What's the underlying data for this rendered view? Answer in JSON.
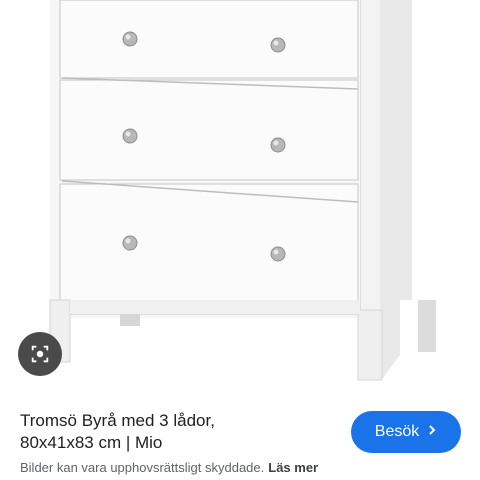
{
  "product": {
    "title_line1": "Tromsö Byrå med 3 lådor,",
    "title_line2": "80x41x83 cm | Mio",
    "image_subject": "white-3-drawer-chest"
  },
  "actions": {
    "visit_label": "Besök",
    "visit_icon": "chevron-right-icon",
    "lens_icon": "lens-icon"
  },
  "footer": {
    "copyright_text": "Bilder kan vara upphovsrättsligt skyddade.",
    "read_more_label": "Läs mer"
  },
  "colors": {
    "accent": "#1a73e8",
    "lens_bg": "#4a4a4a",
    "text_primary": "#202124",
    "text_secondary": "#5f6368"
  }
}
